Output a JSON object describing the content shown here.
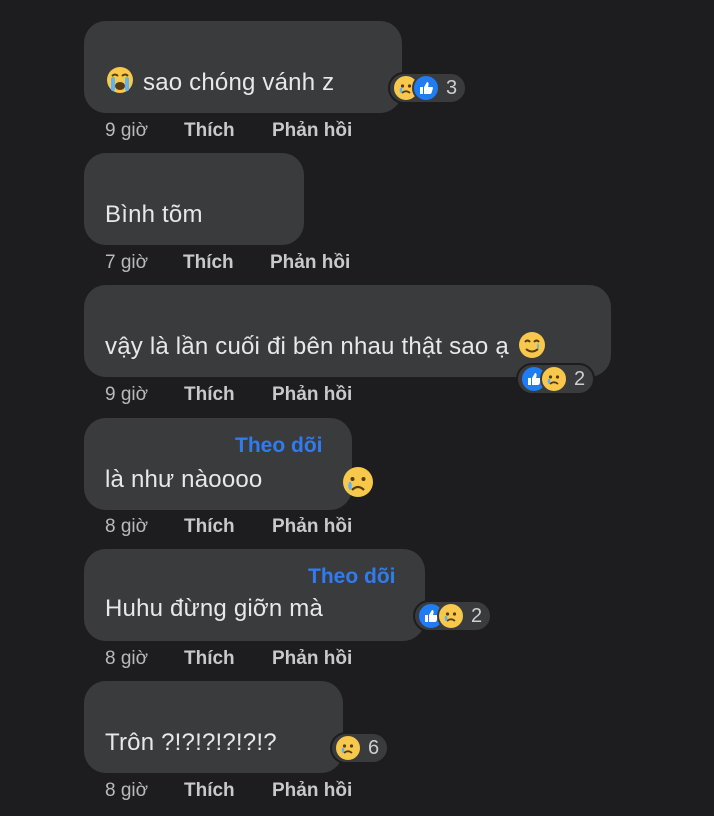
{
  "comments": [
    {
      "text": "sao chóng vánh z",
      "leading_icon": "loudly-crying-face-icon",
      "time": "9 giờ",
      "like": "Thích",
      "reply": "Phản hồi",
      "reactions": [
        "sad-face-icon",
        "like-icon"
      ],
      "reaction_count": "3"
    },
    {
      "text": "Bình tõm",
      "time": "7 giờ",
      "like": "Thích",
      "reply": "Phản hồi"
    },
    {
      "text": "vậy là lần cuối đi bên nhau thật sao ạ",
      "trailing_icon": "smiling-with-tear-icon",
      "time": "9 giờ",
      "like": "Thích",
      "reply": "Phản hồi",
      "reactions": [
        "like-icon",
        "sad-face-icon"
      ],
      "reaction_count": "2"
    },
    {
      "follow": "Theo dõi",
      "text": "là như nàoooo",
      "trailing_icon": "sad-face-icon",
      "time": "8 giờ",
      "like": "Thích",
      "reply": "Phản hồi"
    },
    {
      "follow": "Theo dõi",
      "text": "Huhu đừng giỡn mà",
      "time": "8 giờ",
      "like": "Thích",
      "reply": "Phản hồi",
      "reactions": [
        "like-icon",
        "sad-face-icon"
      ],
      "reaction_count": "2"
    },
    {
      "text": "Trôn ?!?!?!?!?!?",
      "time": "8 giờ",
      "like": "Thích",
      "reply": "Phản hồi",
      "reactions": [
        "sad-face-icon"
      ],
      "reaction_count": "6"
    }
  ],
  "colors": {
    "background": "#1d1d1f",
    "bubble": "#3a3b3d",
    "follow_link": "#2f7bf0",
    "like_blue": "#1f7cf2",
    "emoji_yellow": "#f7c84c"
  }
}
